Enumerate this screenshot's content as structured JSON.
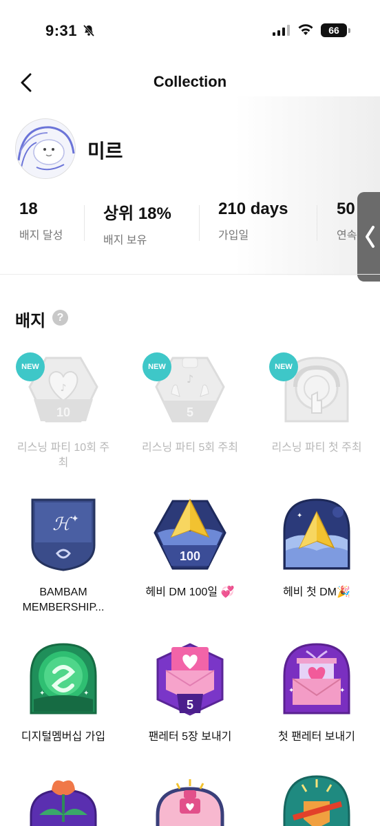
{
  "status_bar": {
    "time": "9:31",
    "battery": "66"
  },
  "nav": {
    "title": "Collection"
  },
  "profile": {
    "name": "미르"
  },
  "stats": [
    {
      "value": "18",
      "label": "배지 달성"
    },
    {
      "value": "상위 18%",
      "label": "배지 보유"
    },
    {
      "value": "210 days",
      "label": "가입일"
    },
    {
      "value": "50",
      "label": "연속"
    }
  ],
  "badges_section": {
    "title": "배지",
    "help": "?"
  },
  "badges": [
    {
      "label": "리스닝 파티 10회 주최",
      "new_tag": "NEW",
      "number": "10",
      "state": "inactive"
    },
    {
      "label": "리스닝 파티 5회 주최",
      "new_tag": "NEW",
      "number": "5",
      "state": "inactive"
    },
    {
      "label": "리스닝 파티 첫 주최",
      "new_tag": "NEW",
      "state": "inactive"
    },
    {
      "label": "BAMBAM MEMBERSHIP...",
      "state": "active"
    },
    {
      "label": "헤비 DM 100일 💞",
      "number": "100",
      "state": "active"
    },
    {
      "label": "헤비 첫 DM🎉",
      "state": "active"
    },
    {
      "label": "디지털멤버십 가입",
      "state": "active"
    },
    {
      "label": "팬레터 5장 보내기",
      "number": "5",
      "state": "active"
    },
    {
      "label": "첫 팬레터 보내기",
      "state": "active"
    }
  ]
}
